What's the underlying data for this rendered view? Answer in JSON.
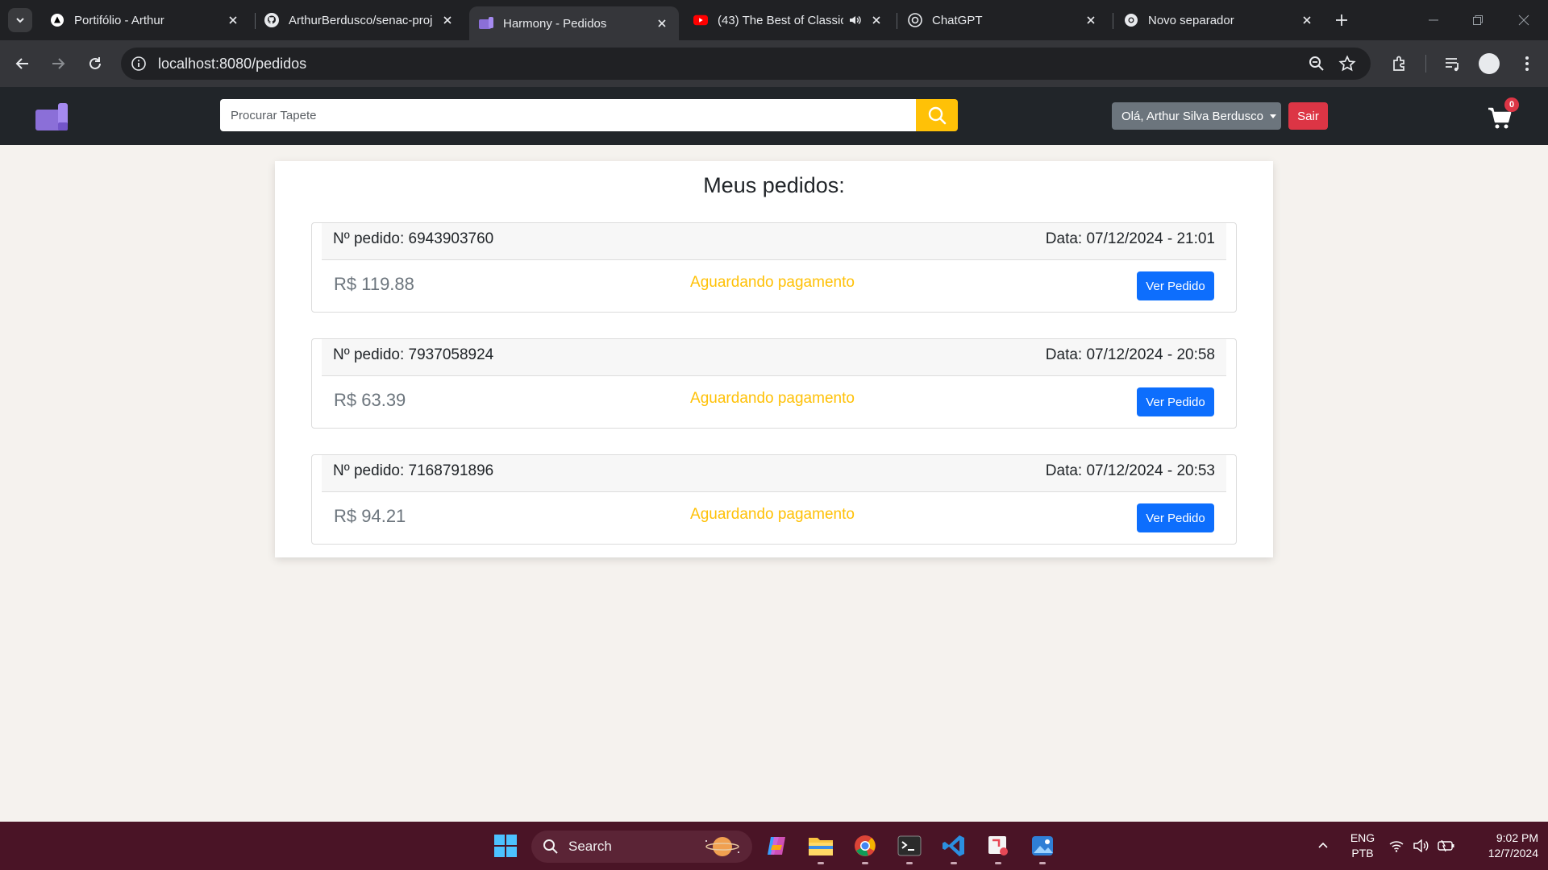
{
  "browser": {
    "tabs": [
      {
        "title": "Portifólio - Arthur",
        "icon": "triangle-icon"
      },
      {
        "title": "ArthurBerdusco/senac-proj",
        "icon": "github-icon"
      },
      {
        "title": "Harmony - Pedidos",
        "icon": "harmony-logo-icon",
        "active": true
      },
      {
        "title": "(43) The Best of Classic",
        "icon": "youtube-icon"
      },
      {
        "title": "ChatGPT",
        "icon": "chatgpt-icon"
      },
      {
        "title": "Novo separador",
        "icon": "chrome-icon"
      }
    ],
    "url": "localhost:8080/pedidos"
  },
  "header": {
    "search_placeholder": "Procurar Tapete",
    "user_label": "Olá, Arthur Silva Berdusco",
    "logout_label": "Sair",
    "cart_count": "0"
  },
  "page": {
    "title": "Meus pedidos:",
    "orders": [
      {
        "number_label": "Nº pedido: 6943903760",
        "date_label": "Data: 07/12/2024 - 21:01",
        "price": "R$ 119.88",
        "status": "Aguardando pagamento",
        "action": "Ver Pedido"
      },
      {
        "number_label": "Nº pedido: 7937058924",
        "date_label": "Data: 07/12/2024 - 20:58",
        "price": "R$ 63.39",
        "status": "Aguardando pagamento",
        "action": "Ver Pedido"
      },
      {
        "number_label": "Nº pedido: 7168791896",
        "date_label": "Data: 07/12/2024 - 20:53",
        "price": "R$ 94.21",
        "status": "Aguardando pagamento",
        "action": "Ver Pedido"
      }
    ]
  },
  "taskbar": {
    "search_label": "Search",
    "lang_top": "ENG",
    "lang_bottom": "PTB",
    "time": "9:02 PM",
    "date": "12/7/2024"
  },
  "colors": {
    "accent_warning": "#ffc107",
    "primary": "#0d6efd",
    "danger": "#dc3545",
    "brand_purple": "#8b6fd8"
  }
}
